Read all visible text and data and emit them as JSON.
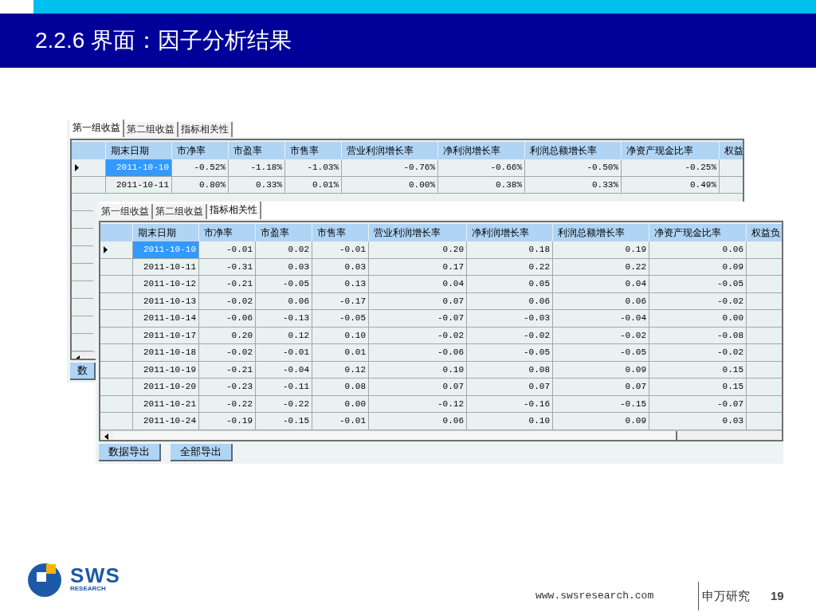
{
  "slide": {
    "title": "2.2.6 界面：因子分析结果"
  },
  "windows": [
    {
      "tabs": [
        {
          "label": "第一组收益",
          "selected": true
        },
        {
          "label": "第二组收益",
          "selected": false
        },
        {
          "label": "指标相关性",
          "selected": false
        }
      ],
      "columns": [
        "期末日期",
        "市净率",
        "市盈率",
        "市售率",
        "营业利润增长率",
        "净利润增长率",
        "利润总额增长率",
        "净资产现金比率",
        "权益"
      ],
      "rows": [
        {
          "current": true,
          "selected": true,
          "cells": [
            "2011-10-10",
            "-0.52%",
            "-1.18%",
            "-1.03%",
            "-0.76%",
            "-0.66%",
            "-0.50%",
            "-0.25%"
          ]
        },
        {
          "current": false,
          "selected": false,
          "cells": [
            "2011-10-11",
            "0.80%",
            "0.33%",
            "0.01%",
            "0.00%",
            "0.38%",
            "0.33%",
            "0.49%"
          ]
        }
      ],
      "buttons": [
        "数"
      ]
    },
    {
      "tabs": [
        {
          "label": "第一组收益",
          "selected": false
        },
        {
          "label": "第二组收益",
          "selected": false
        },
        {
          "label": "指标相关性",
          "selected": true
        }
      ],
      "columns": [
        "期末日期",
        "市净率",
        "市盈率",
        "市售率",
        "营业利润增长率",
        "净利润增长率",
        "利润总额增长率",
        "净资产现金比率",
        "权益负"
      ],
      "rows": [
        {
          "current": true,
          "selected": true,
          "cells": [
            "2011-10-10",
            "-0.01",
            "0.02",
            "-0.01",
            "0.20",
            "0.18",
            "0.19",
            "0.06"
          ]
        },
        {
          "current": false,
          "selected": false,
          "cells": [
            "2011-10-11",
            "-0.31",
            "0.03",
            "0.03",
            "0.17",
            "0.22",
            "0.22",
            "0.09"
          ]
        },
        {
          "current": false,
          "selected": false,
          "cells": [
            "2011-10-12",
            "-0.21",
            "-0.05",
            "0.13",
            "0.04",
            "0.05",
            "0.04",
            "-0.05"
          ]
        },
        {
          "current": false,
          "selected": false,
          "cells": [
            "2011-10-13",
            "-0.02",
            "0.06",
            "-0.17",
            "0.07",
            "0.06",
            "0.06",
            "-0.02"
          ]
        },
        {
          "current": false,
          "selected": false,
          "cells": [
            "2011-10-14",
            "-0.06",
            "-0.13",
            "-0.05",
            "-0.07",
            "-0.03",
            "-0.04",
            "0.00"
          ]
        },
        {
          "current": false,
          "selected": false,
          "cells": [
            "2011-10-17",
            "0.20",
            "0.12",
            "0.10",
            "-0.02",
            "-0.02",
            "-0.02",
            "-0.08"
          ]
        },
        {
          "current": false,
          "selected": false,
          "cells": [
            "2011-10-18",
            "-0.02",
            "-0.01",
            "0.01",
            "-0.06",
            "-0.05",
            "-0.05",
            "-0.02"
          ]
        },
        {
          "current": false,
          "selected": false,
          "cells": [
            "2011-10-19",
            "-0.21",
            "-0.04",
            "0.12",
            "0.10",
            "0.08",
            "0.09",
            "0.15"
          ]
        },
        {
          "current": false,
          "selected": false,
          "cells": [
            "2011-10-20",
            "-0.23",
            "-0.11",
            "0.08",
            "0.07",
            "0.07",
            "0.07",
            "0.15"
          ]
        },
        {
          "current": false,
          "selected": false,
          "cells": [
            "2011-10-21",
            "-0.22",
            "-0.22",
            "0.00",
            "-0.12",
            "-0.16",
            "-0.15",
            "-0.07"
          ]
        },
        {
          "current": false,
          "selected": false,
          "cells": [
            "2011-10-24",
            "-0.19",
            "-0.15",
            "-0.01",
            "0.06",
            "0.10",
            "0.09",
            "0.03"
          ]
        }
      ],
      "buttons": [
        "数据导出",
        "全部导出"
      ]
    }
  ],
  "footer": {
    "logo_text": "SWS",
    "logo_subtext": "RESEARCH",
    "url": "www.swsresearch.com",
    "org": "申万研究",
    "page": "19"
  }
}
